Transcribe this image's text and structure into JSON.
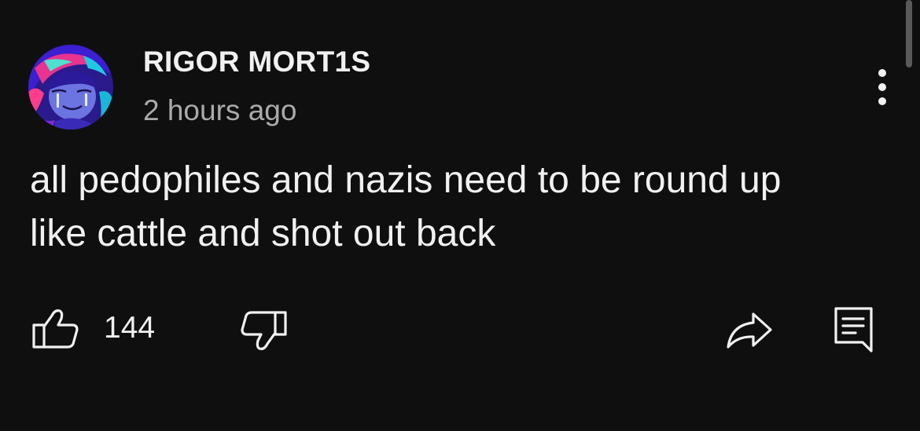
{
  "comment": {
    "author": "RIGOR MORT1S",
    "timestamp": "2 hours ago",
    "text": "all pedophiles and nazis need to be round up\nlike cattle and shot out back",
    "avatar_icon": "anime-avatar-icon"
  },
  "actions": {
    "like_count": "144",
    "like_icon": "thumbs-up-icon",
    "dislike_icon": "thumbs-down-icon",
    "share_icon": "share-arrow-icon",
    "reply_icon": "reply-comment-icon",
    "menu_icon": "more-vertical-icon"
  },
  "colors": {
    "background": "#0f0f0f",
    "text_primary": "#f1f1f1",
    "text_secondary": "#aaaaaa"
  }
}
